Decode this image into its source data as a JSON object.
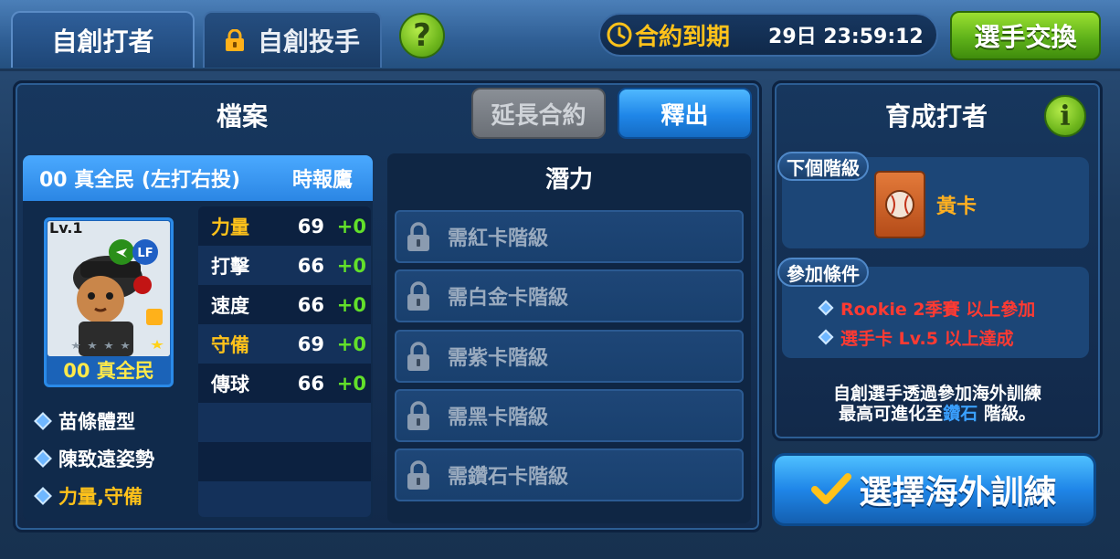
{
  "tabs": [
    {
      "label": "自創打者",
      "active": true
    },
    {
      "label": "自創投手",
      "active": false,
      "locked": true
    }
  ],
  "help_label": "?",
  "contract": {
    "label": "合約到期",
    "time": "29日 23:59:12"
  },
  "exchange_button": "選手交換",
  "profile": {
    "title": "檔案",
    "extend_button": "延長合約",
    "release_button": "釋出",
    "player_header": "00 真全民 (左打右投)",
    "team": "時報鷹",
    "card": {
      "level": "Lv.1",
      "position": "LF",
      "name": "00 真全民"
    },
    "traits": [
      {
        "label": "苗條體型",
        "color": "#ffffff"
      },
      {
        "label": "陳致遠姿勢",
        "color": "#ffffff"
      },
      {
        "label": "力量,守備",
        "color": "#ffc21a"
      }
    ],
    "stats": [
      {
        "name": "力量",
        "value": "69",
        "bonus": "+0",
        "color": "#ffc21a"
      },
      {
        "name": "打擊",
        "value": "66",
        "bonus": "+0",
        "color": "#ffffff"
      },
      {
        "name": "速度",
        "value": "66",
        "bonus": "+0",
        "color": "#ffffff"
      },
      {
        "name": "守備",
        "value": "69",
        "bonus": "+0",
        "color": "#ffc21a"
      },
      {
        "name": "傳球",
        "value": "66",
        "bonus": "+0",
        "color": "#ffffff"
      }
    ]
  },
  "potential": {
    "title": "潛力",
    "rows": [
      "需紅卡階級",
      "需白金卡階級",
      "需紫卡階級",
      "需黑卡階級",
      "需鑽石卡階級"
    ]
  },
  "growth": {
    "title": "育成打者",
    "info_label": "i",
    "next_rank_label": "下個階級",
    "next_rank_name": "黃卡",
    "conditions_label": "參加條件",
    "conditions": [
      "Rookie 2季賽 以上參加",
      "選手卡 Lv.5 以上達成"
    ],
    "note_line1": "自創選手透過參加海外訓練",
    "note_line2_a": "最高可進化至",
    "note_line2_hl": "鑽石",
    "note_line2_b": " 階級。",
    "train_button": "選擇海外訓練"
  }
}
